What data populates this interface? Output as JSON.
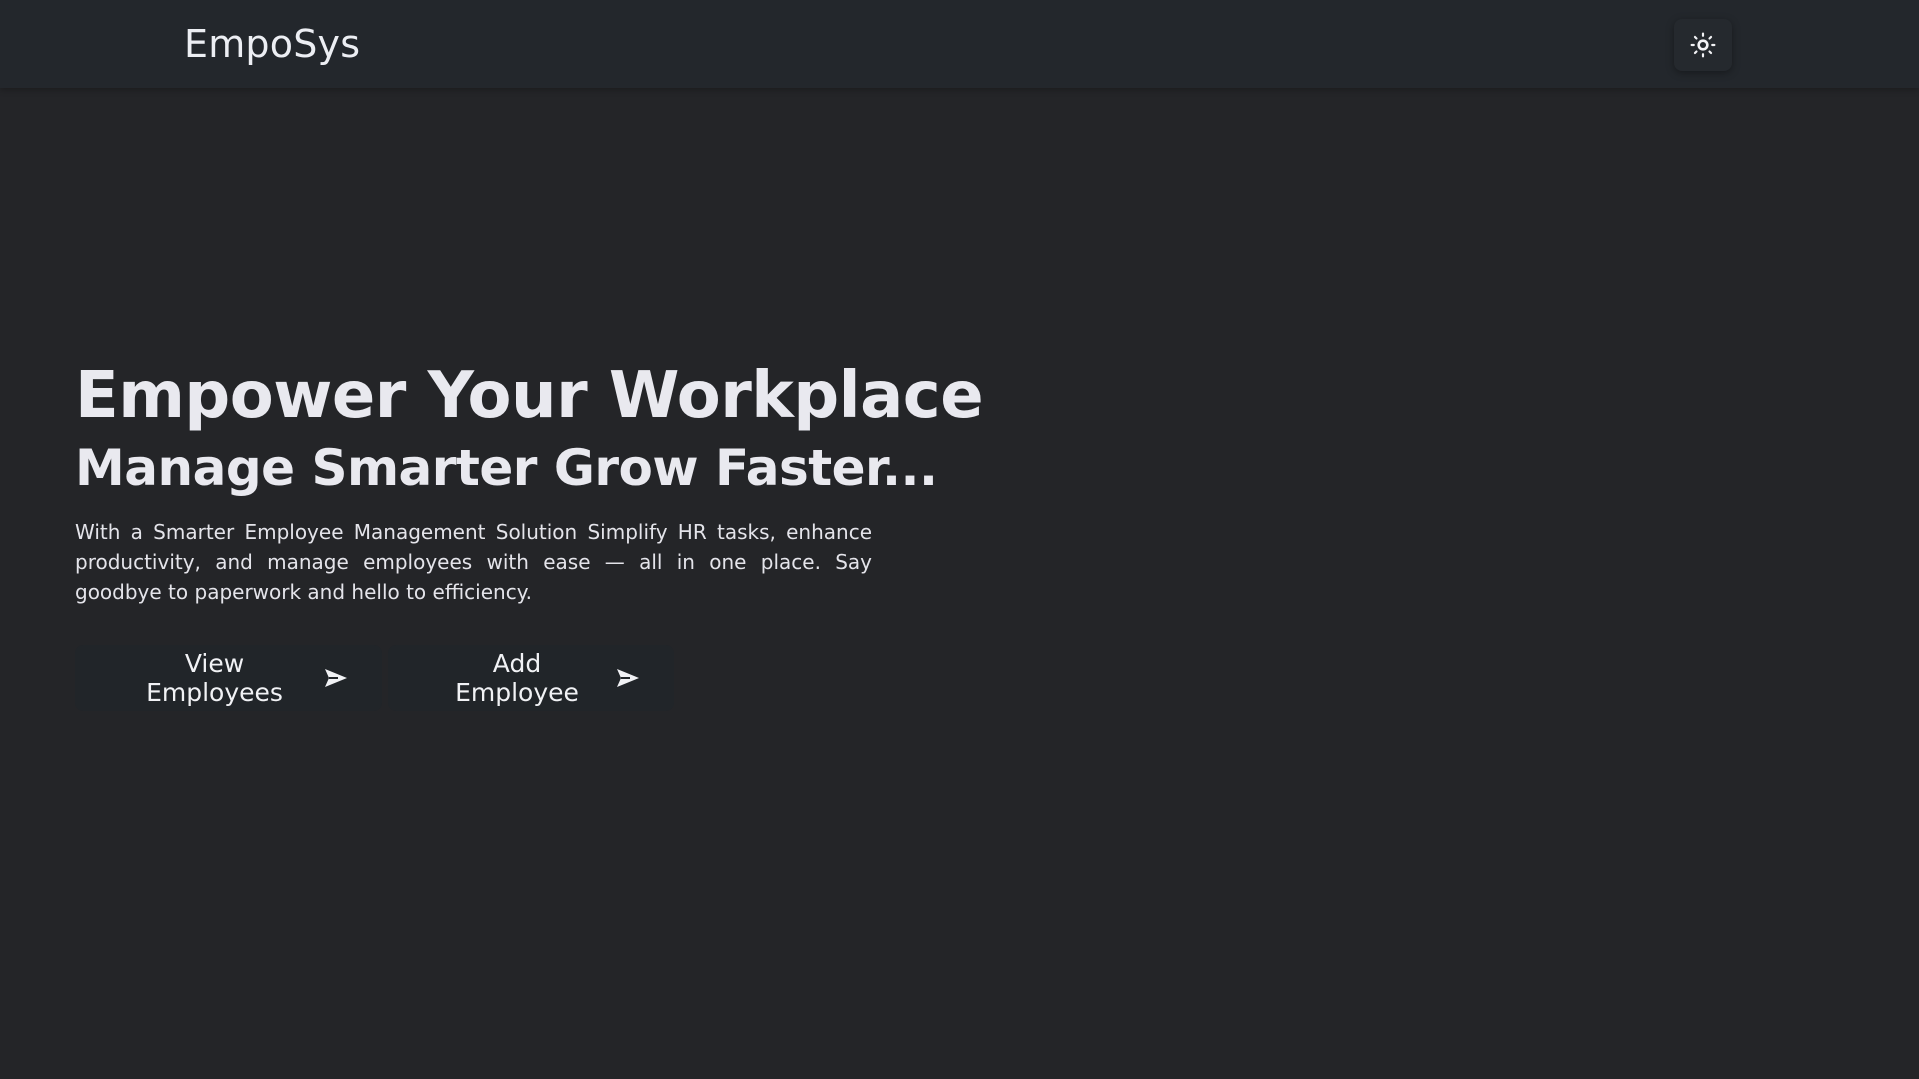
{
  "navbar": {
    "brand": "EmpoSys",
    "theme_toggle_icon": "sun-icon"
  },
  "hero": {
    "title": "Empower Your Workplace",
    "subtitle": "Manage Smarter Grow Faster...",
    "description": "With a Smarter Employee Management Solution Simplify HR tasks, enhance productivity, and manage employees with ease — all in one place. Say goodbye to paperwork and hello to efficiency."
  },
  "actions": {
    "view_employees_label": "View Employees",
    "add_employee_label": "Add Employee",
    "button_icon": "send-arrow-icon"
  },
  "colors": {
    "background": "#242528",
    "navbar": "#23272c",
    "button": "#212529",
    "text": "#e9e9ef"
  }
}
